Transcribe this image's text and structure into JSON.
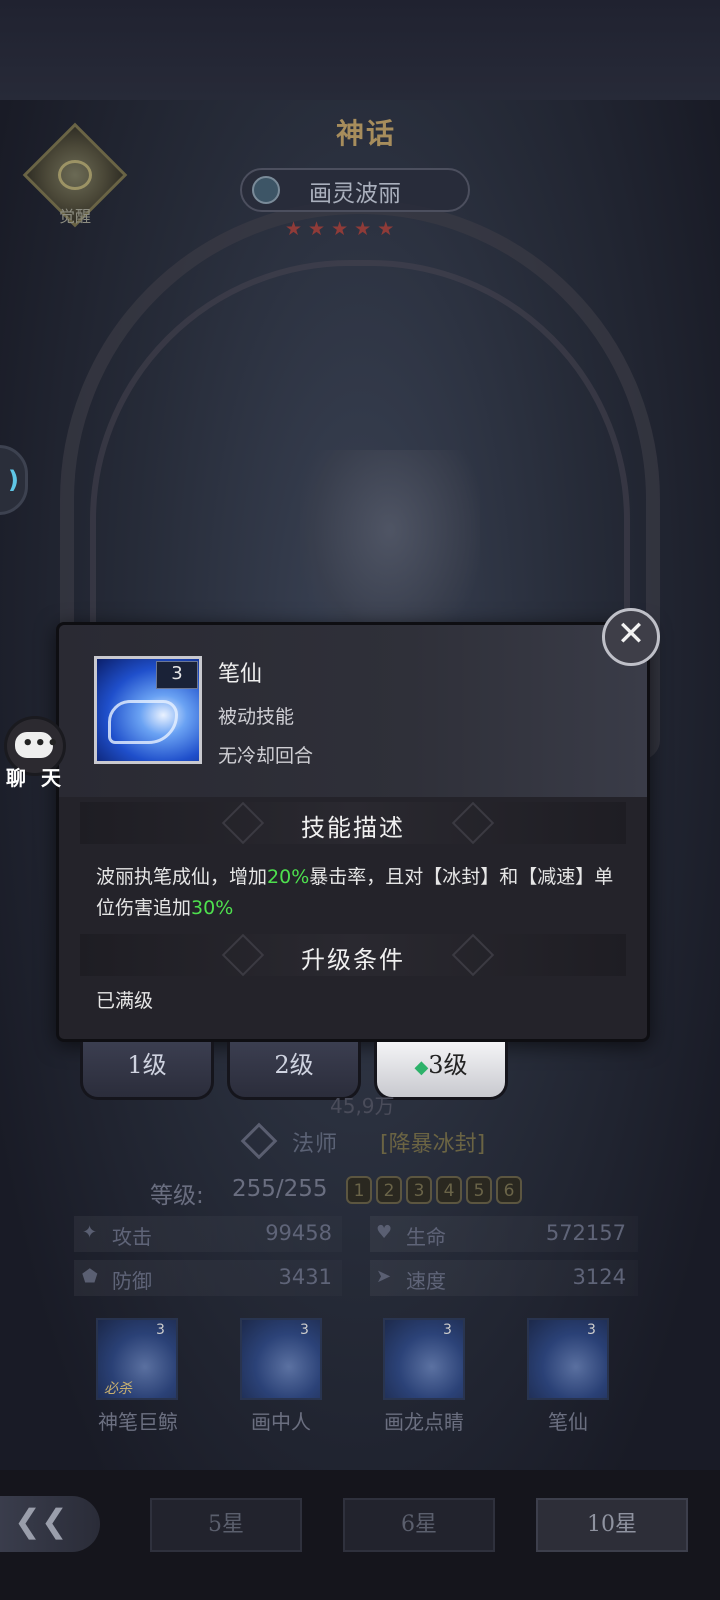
{
  "header": {
    "rarity": "神话",
    "hero_name": "画灵波丽",
    "stars": [
      "★",
      "★",
      "★",
      "★",
      "★"
    ],
    "awaken_label": "觉醒"
  },
  "chat": {
    "label": "聊 天"
  },
  "popup": {
    "skill_level": "3",
    "skill_name": "笔仙",
    "skill_type": "被动技能",
    "cooldown": "无冷却回合",
    "desc_title": "技能描述",
    "desc_parts": [
      "波丽执笔成仙，增加",
      "20%",
      "暴击率，且对【冰封】和【减速】单位伤害追加",
      "30%"
    ],
    "upgrade_title": "升级条件",
    "upgrade_text": "已满级",
    "close_glyph": "✕"
  },
  "level_tabs": [
    {
      "label": "1级",
      "active": false
    },
    {
      "label": "2级",
      "active": false
    },
    {
      "label": "3级",
      "active": true
    }
  ],
  "hero_info": {
    "power": "45,9万",
    "class": "法师",
    "class_tag": "[降暴冰封]",
    "level_label": "等级:",
    "level_value": "255/255",
    "level_badges": [
      "1",
      "2",
      "3",
      "4",
      "5",
      "6"
    ]
  },
  "stats": [
    {
      "icon": "sword-icon",
      "label": "攻击",
      "value": "99458"
    },
    {
      "icon": "heart-icon",
      "label": "生命",
      "value": "572157"
    },
    {
      "icon": "shield-icon",
      "label": "防御",
      "value": "3431"
    },
    {
      "icon": "boot-icon",
      "label": "速度",
      "value": "3124"
    }
  ],
  "skills": [
    {
      "name": "神笔巨鲸",
      "level": "3",
      "tag": "必杀"
    },
    {
      "name": "画中人",
      "level": "3"
    },
    {
      "name": "画龙点睛",
      "level": "3"
    },
    {
      "name": "笔仙",
      "level": "3"
    }
  ],
  "star_tabs": [
    {
      "label": "5星",
      "active": false
    },
    {
      "label": "6星",
      "active": false
    },
    {
      "label": "10星",
      "active": true
    }
  ],
  "colors": {
    "highlight_green": "#4ee04e",
    "popup_bg": "#24232a"
  }
}
